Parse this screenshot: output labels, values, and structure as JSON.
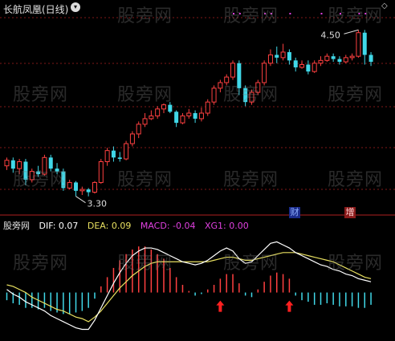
{
  "header": {
    "title": "长航凤凰(日线)",
    "collapse_glyph": "▾",
    "nav_glyph": "◇"
  },
  "watermark": "股旁网",
  "price_labels": {
    "high": "4.50",
    "low": "3.30"
  },
  "tags": {
    "cai": "财",
    "zeng": "增"
  },
  "macd_legend": {
    "name": "股旁网",
    "dif": "DIF: 0.07",
    "dea": "DEA: 0.09",
    "macd": "MACD: -0.04",
    "xg1": "XG1: 0.00"
  },
  "colors": {
    "up": "#ff4040",
    "down": "#40d8e8",
    "dif": "#ffffff",
    "dea": "#e8e060",
    "macd": "#e040e0",
    "grid": "#801818"
  },
  "chart_data": {
    "type": "candlestick+macd",
    "price_range": [
      3.2,
      4.6
    ],
    "candles": [
      [
        3.52,
        3.56,
        3.49,
        3.58
      ],
      [
        3.56,
        3.5,
        3.47,
        3.58
      ],
      [
        3.5,
        3.55,
        3.46,
        3.57
      ],
      [
        3.55,
        3.42,
        3.38,
        3.57
      ],
      [
        3.42,
        3.48,
        3.4,
        3.5
      ],
      [
        3.48,
        3.46,
        3.44,
        3.52
      ],
      [
        3.46,
        3.58,
        3.45,
        3.6
      ],
      [
        3.58,
        3.5,
        3.48,
        3.6
      ],
      [
        3.5,
        3.48,
        3.46,
        3.54
      ],
      [
        3.48,
        3.36,
        3.34,
        3.5
      ],
      [
        3.36,
        3.4,
        3.35,
        3.42
      ],
      [
        3.4,
        3.34,
        3.3,
        3.41
      ],
      [
        3.34,
        3.35,
        3.31,
        3.37
      ],
      [
        3.35,
        3.33,
        3.3,
        3.36
      ],
      [
        3.33,
        3.4,
        3.32,
        3.41
      ],
      [
        3.4,
        3.55,
        3.39,
        3.57
      ],
      [
        3.55,
        3.63,
        3.52,
        3.65
      ],
      [
        3.63,
        3.58,
        3.55,
        3.66
      ],
      [
        3.58,
        3.57,
        3.55,
        3.62
      ],
      [
        3.57,
        3.68,
        3.56,
        3.7
      ],
      [
        3.68,
        3.75,
        3.66,
        3.77
      ],
      [
        3.75,
        3.82,
        3.72,
        3.84
      ],
      [
        3.82,
        3.86,
        3.8,
        3.9
      ],
      [
        3.86,
        3.88,
        3.85,
        3.92
      ],
      [
        3.88,
        3.93,
        3.86,
        3.95
      ],
      [
        3.93,
        3.96,
        3.9,
        3.97
      ],
      [
        3.96,
        3.91,
        3.9,
        3.98
      ],
      [
        3.91,
        3.83,
        3.8,
        3.92
      ],
      [
        3.83,
        3.88,
        3.82,
        3.9
      ],
      [
        3.88,
        3.9,
        3.86,
        3.93
      ],
      [
        3.9,
        3.86,
        3.83,
        3.92
      ],
      [
        3.86,
        3.9,
        3.84,
        3.94
      ],
      [
        3.9,
        3.98,
        3.88,
        4.0
      ],
      [
        3.98,
        4.08,
        3.96,
        4.1
      ],
      [
        4.08,
        4.12,
        4.05,
        4.14
      ],
      [
        4.12,
        4.16,
        4.1,
        4.18
      ],
      [
        4.16,
        4.26,
        4.14,
        4.28
      ],
      [
        4.26,
        4.08,
        4.03,
        4.28
      ],
      [
        4.08,
        3.98,
        3.95,
        4.1
      ],
      [
        3.98,
        4.05,
        3.96,
        4.07
      ],
      [
        4.05,
        4.12,
        4.03,
        4.14
      ],
      [
        4.12,
        4.26,
        4.1,
        4.28
      ],
      [
        4.26,
        4.32,
        4.24,
        4.36
      ],
      [
        4.32,
        4.3,
        4.26,
        4.38
      ],
      [
        4.3,
        4.34,
        4.28,
        4.4
      ],
      [
        4.34,
        4.28,
        4.25,
        4.36
      ],
      [
        4.28,
        4.23,
        4.2,
        4.3
      ],
      [
        4.23,
        4.25,
        4.22,
        4.28
      ],
      [
        4.25,
        4.2,
        4.18,
        4.28
      ],
      [
        4.2,
        4.26,
        4.19,
        4.28
      ],
      [
        4.26,
        4.28,
        4.24,
        4.31
      ],
      [
        4.28,
        4.31,
        4.27,
        4.33
      ],
      [
        4.31,
        4.29,
        4.27,
        4.33
      ],
      [
        4.29,
        4.27,
        4.25,
        4.31
      ],
      [
        4.27,
        4.3,
        4.26,
        4.32
      ],
      [
        4.3,
        4.31,
        4.28,
        4.33
      ],
      [
        4.31,
        4.48,
        4.3,
        4.5
      ],
      [
        4.48,
        4.32,
        4.25,
        4.5
      ],
      [
        4.32,
        4.27,
        4.24,
        4.34
      ]
    ],
    "low_marker_index": 11,
    "high_marker_index": 56,
    "buy_arrow_indices": [
      34,
      45
    ],
    "macd": {
      "bars": [
        -0.05,
        -0.07,
        -0.08,
        -0.1,
        -0.1,
        -0.11,
        -0.1,
        -0.12,
        -0.13,
        -0.14,
        -0.14,
        -0.13,
        -0.12,
        -0.1,
        -0.04,
        0.04,
        0.1,
        0.16,
        0.21,
        0.25,
        0.28,
        0.3,
        0.3,
        0.28,
        0.25,
        0.22,
        0.16,
        0.1,
        0.05,
        0.01,
        -0.02,
        -0.01,
        0.02,
        0.05,
        0.09,
        0.12,
        0.12,
        0.06,
        -0.02,
        -0.03,
        0.02,
        0.07,
        0.11,
        0.13,
        0.12,
        0.09,
        -0.02,
        -0.05,
        -0.06,
        -0.08,
        -0.08,
        -0.07,
        -0.08,
        -0.09,
        -0.09,
        -0.09,
        -0.1,
        -0.1,
        -0.08
      ],
      "dif": [
        0.02,
        -0.01,
        -0.03,
        -0.06,
        -0.08,
        -0.1,
        -0.12,
        -0.15,
        -0.17,
        -0.19,
        -0.21,
        -0.23,
        -0.24,
        -0.24,
        -0.18,
        -0.1,
        -0.02,
        0.06,
        0.13,
        0.19,
        0.24,
        0.27,
        0.29,
        0.29,
        0.28,
        0.26,
        0.24,
        0.22,
        0.2,
        0.19,
        0.18,
        0.19,
        0.21,
        0.24,
        0.27,
        0.29,
        0.27,
        0.22,
        0.19,
        0.2,
        0.24,
        0.28,
        0.32,
        0.33,
        0.31,
        0.29,
        0.26,
        0.24,
        0.22,
        0.2,
        0.18,
        0.17,
        0.15,
        0.14,
        0.12,
        0.11,
        0.09,
        0.08,
        0.07
      ],
      "dea": [
        0.05,
        0.04,
        0.02,
        0.0,
        -0.03,
        -0.05,
        -0.07,
        -0.09,
        -0.11,
        -0.12,
        -0.14,
        -0.16,
        -0.17,
        -0.19,
        -0.16,
        -0.12,
        -0.07,
        -0.02,
        0.03,
        0.07,
        0.11,
        0.14,
        0.17,
        0.19,
        0.2,
        0.2,
        0.2,
        0.2,
        0.2,
        0.2,
        0.2,
        0.2,
        0.2,
        0.21,
        0.22,
        0.23,
        0.23,
        0.22,
        0.21,
        0.21,
        0.22,
        0.23,
        0.24,
        0.25,
        0.26,
        0.26,
        0.26,
        0.25,
        0.24,
        0.23,
        0.22,
        0.21,
        0.2,
        0.18,
        0.16,
        0.14,
        0.12,
        0.1,
        0.09
      ],
      "range": [
        -0.3,
        0.4
      ]
    }
  }
}
